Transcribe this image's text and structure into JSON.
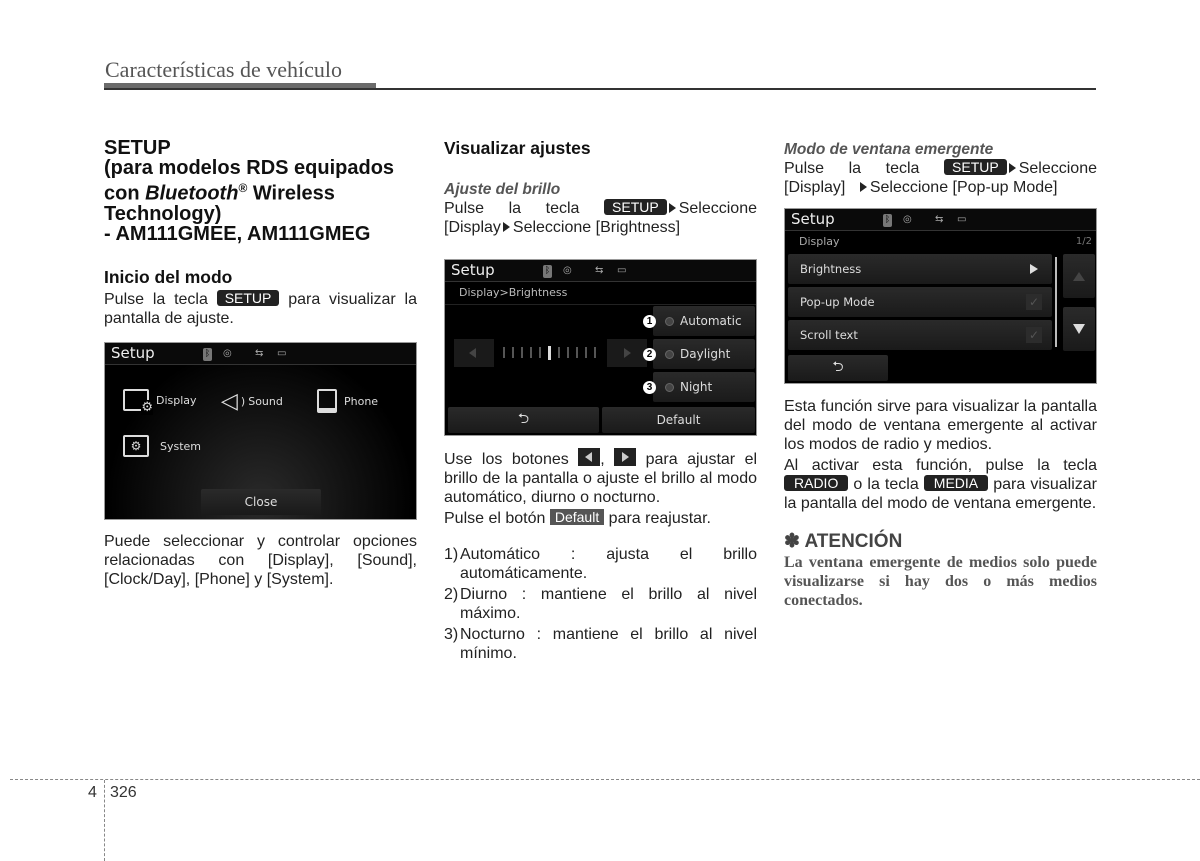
{
  "header": {
    "title": "Características de vehículo"
  },
  "col1": {
    "heading_lines": [
      "SETUP",
      "(para modelos RDS equipados",
      "con ",
      "Bluetooth",
      "®",
      " Wireless",
      "Technology)",
      "- AM111GMEE, AM111GMEG"
    ],
    "section_title": "Inicio del modo",
    "p1_before": "Pulse la tecla",
    "p1_key": "SETUP",
    "p1_after": "para visualizar la pantalla de ajuste.",
    "screen": {
      "title": "Setup",
      "menu": [
        {
          "label": "Display",
          "icon": "display-settings-icon"
        },
        {
          "label": "Sound",
          "icon": "speaker-icon"
        },
        {
          "label": "Phone",
          "icon": "phone-icon"
        },
        {
          "label": "System",
          "icon": "system-folder-icon"
        }
      ],
      "close_label": "Close"
    },
    "p2": "Puede seleccionar y controlar opciones relacionadas con [Display], [Sound], [Clock/Day], [Phone] y [System]."
  },
  "col2": {
    "section_title": "Visualizar ajustes",
    "sub_title": "Ajuste del brillo",
    "p1_before": "Pulse la tecla",
    "p1_key": "SETUP",
    "p1_mid": "Seleccione [Display",
    "p1_after": "Seleccione [Brightness]",
    "screen": {
      "title": "Setup",
      "breadcrumb": "Display>Brightness",
      "brightness_level": 6,
      "brightness_steps": 11,
      "options": [
        {
          "num": "1",
          "label": "Automatic"
        },
        {
          "num": "2",
          "label": "Daylight"
        },
        {
          "num": "3",
          "label": "Night"
        }
      ],
      "default_label": "Default"
    },
    "p2_a": "Use los botones",
    "p2_comma": ",",
    "p2_b": "para ajustar el brillo de la pantalla o ajuste el brillo al modo automático, diurno o nocturno.",
    "p3_a": "Pulse el botón",
    "p3_key": "Default",
    "p3_b": "para reajustar.",
    "list": [
      {
        "num": "1)",
        "text": "Automático : ajusta el brillo automáticamente."
      },
      {
        "num": "2)",
        "text": "Diurno : mantiene el brillo al nivel máximo."
      },
      {
        "num": "3)",
        "text": "Nocturno : mantiene el brillo al nivel mínimo."
      }
    ]
  },
  "col3": {
    "sub_title": "Modo de ventana emergente",
    "p1_before": "Pulse la tecla",
    "p1_key": "SETUP",
    "p1_mid": "Seleccione [Display]",
    "p1_after": "Seleccione [Pop-up Mode]",
    "screen": {
      "title": "Setup",
      "subtitle": "Display",
      "page": "1/2",
      "rows": [
        {
          "label": "Brightness",
          "type": "arrow"
        },
        {
          "label": "Pop-up Mode",
          "type": "check"
        },
        {
          "label": "Scroll text",
          "type": "check"
        }
      ]
    },
    "p2": "Esta función sirve para visualizar la pantalla del modo de ventana emergente al activar los modos de radio y medios.",
    "p3_a": "Al activar esta función, pulse la tecla",
    "p3_key1": "RADIO",
    "p3_b": "o la tecla",
    "p3_key2": "MEDIA",
    "p3_c": "para visualizar la pantalla del modo de ventana emergente.",
    "attention_title": "✽ ATENCIÓN",
    "attention_body": "La ventana emergente de medios solo puede visualizarse si hay dos o más medios conectados."
  },
  "footer": {
    "chapter": "4",
    "page": "326"
  }
}
